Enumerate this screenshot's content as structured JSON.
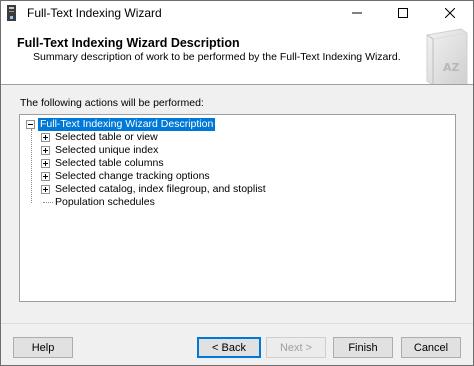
{
  "window": {
    "title": "Full-Text Indexing Wizard",
    "icon": "app-icon"
  },
  "banner": {
    "title": "Full-Text Indexing Wizard Description",
    "subtitle": "Summary description of work to be performed by the Full-Text Indexing Wizard.",
    "icon": "book-icon",
    "icon_text": "AZ"
  },
  "intro_label": "The following actions will be performed:",
  "tree": {
    "root": {
      "label": "Full-Text Indexing Wizard Description",
      "expanded": true,
      "selected": true
    },
    "items": [
      {
        "label": "Selected table or view",
        "expandable": true
      },
      {
        "label": "Selected unique index",
        "expandable": true
      },
      {
        "label": "Selected table columns",
        "expandable": true
      },
      {
        "label": "Selected change tracking options",
        "expandable": true
      },
      {
        "label": "Selected catalog, index filegroup, and stoplist",
        "expandable": true
      },
      {
        "label": "Population schedules",
        "expandable": false
      }
    ]
  },
  "buttons": {
    "help": "Help",
    "back": "< Back",
    "next": "Next >",
    "finish": "Finish",
    "cancel": "Cancel"
  },
  "colors": {
    "selection": "#0078d7",
    "accent_border": "#0078d7"
  }
}
